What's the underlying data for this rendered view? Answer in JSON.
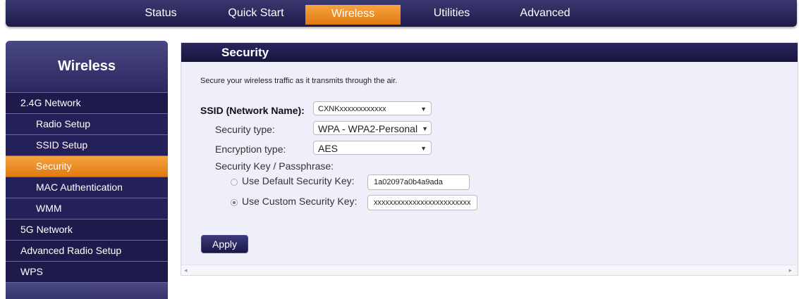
{
  "topnav": {
    "tabs": [
      {
        "label": "Status"
      },
      {
        "label": "Quick Start"
      },
      {
        "label": "Wireless",
        "active": true
      },
      {
        "label": "Utilities"
      },
      {
        "label": "Advanced"
      }
    ]
  },
  "sidebar": {
    "title": "Wireless",
    "items": [
      {
        "label": "2.4G Network"
      },
      {
        "label": "Radio Setup"
      },
      {
        "label": "SSID Setup"
      },
      {
        "label": "Security",
        "active": true
      },
      {
        "label": "MAC Authentication"
      },
      {
        "label": "WMM"
      },
      {
        "label": "5G Network"
      },
      {
        "label": "Advanced Radio Setup"
      },
      {
        "label": "WPS"
      }
    ]
  },
  "main": {
    "title": "Security",
    "description": "Secure your wireless traffic as it transmits through the air.",
    "ssid_label": "SSID (Network Name):",
    "ssid_value": "CXNKxxxxxxxxxxxx",
    "security_type_label": "Security type:",
    "security_type_value": "WPA - WPA2-Personal",
    "encryption_type_label": "Encryption type:",
    "encryption_type_value": "AES",
    "passphrase_label": "Security Key / Passphrase:",
    "default_key_label": "Use Default Security Key:",
    "default_key_value": "1a02097a0b4a9ada",
    "custom_key_label": "Use Custom Security Key:",
    "custom_key_value": "xxxxxxxxxxxxxxxxxxxxxxxxx",
    "apply_label": "Apply",
    "selected_key_option": "custom"
  },
  "icons": {
    "dropdown": "chevron-down-icon",
    "scroll_left": "scroll-left-icon",
    "scroll_right": "scroll-right-icon"
  },
  "colors": {
    "nav_bg": "#1c1a4a",
    "accent_orange": "#e07a10",
    "panel_bg": "#efeff9"
  }
}
